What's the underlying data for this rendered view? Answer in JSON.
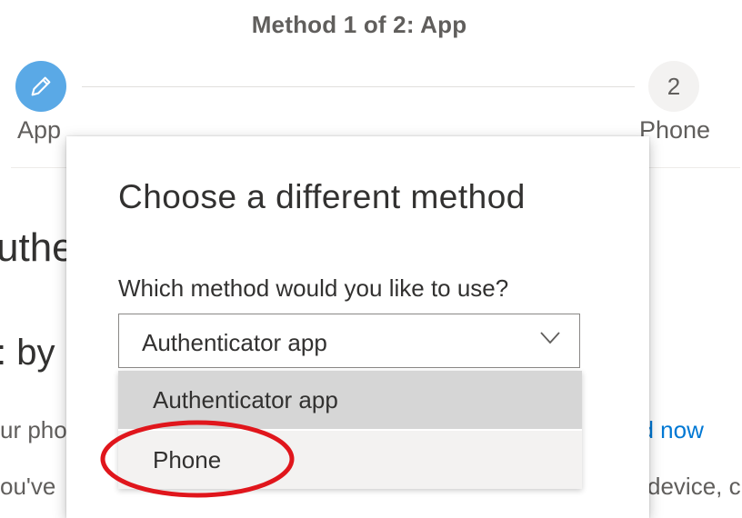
{
  "wizard": {
    "title": "Method 1 of 2: App",
    "steps": [
      {
        "label": "App",
        "icon": "pencil-icon",
        "state": "active"
      },
      {
        "label": "Phone",
        "number": "2",
        "state": "pending"
      }
    ]
  },
  "background": {
    "heading_partial": "uthe",
    "subheading_partial": ": by",
    "text_line1_partial": "ur pho",
    "link_partial": "ad now",
    "text_line2_partial": "ou've",
    "text_line2_right_partial": "device, c"
  },
  "dialog": {
    "title": "Choose a different method",
    "question": "Which method would you like to use?",
    "select": {
      "value": "Authenticator app",
      "options": [
        "Authenticator app",
        "Phone"
      ]
    }
  },
  "colors": {
    "accent": "#0078d4",
    "step_active": "#5aa9e6",
    "annotation": "#e0161c"
  }
}
